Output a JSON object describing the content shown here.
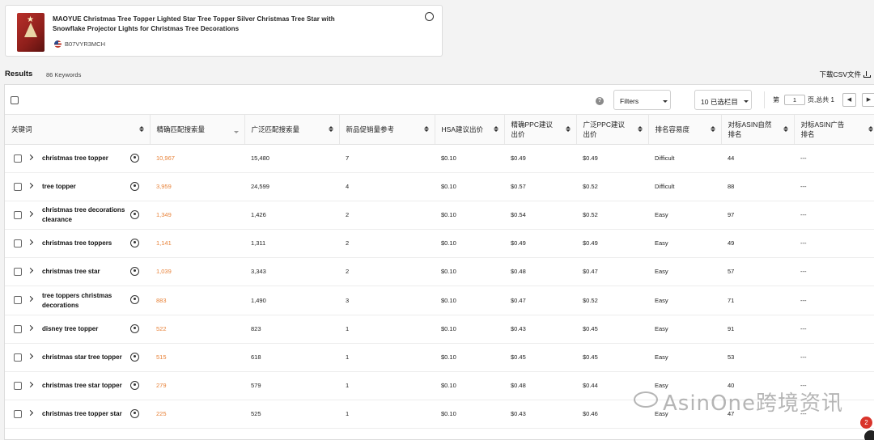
{
  "product": {
    "title": "MAOYUE Christmas Tree Topper Lighted Star Tree Topper Silver Christmas Tree Star with Snowflake Projector Lights for Christmas Tree Decorations",
    "asin": "B07VYR3MCH"
  },
  "results": {
    "label": "Results",
    "count": "86 Keywords",
    "download": "下载CSV文件"
  },
  "toolbar": {
    "filters": "Filters",
    "columns": "10 已选栏目",
    "page_prefix": "第",
    "page_value": "1",
    "page_suffix": "页,总共 1",
    "prev": "◀",
    "next": "▶"
  },
  "table": {
    "headers": [
      "关键词",
      "精确匹配搜索量",
      "广泛匹配搜索量",
      "新品促销量参考",
      "HSA建议出价",
      "精确PPC建议出价",
      "广泛PPC建议出价",
      "排名容易度",
      "对标ASIN自然排名",
      "对标ASIN广告排名"
    ],
    "rows": [
      {
        "keyword": "christmas tree topper",
        "exact": "10,967",
        "broad": "15,480",
        "promo": "7",
        "hsa": "$0.10",
        "ppc_exact": "$0.49",
        "ppc_broad": "$0.49",
        "ease": "Difficult",
        "organic": "44",
        "ad": "---"
      },
      {
        "keyword": "tree topper",
        "exact": "3,959",
        "broad": "24,599",
        "promo": "4",
        "hsa": "$0.10",
        "ppc_exact": "$0.57",
        "ppc_broad": "$0.52",
        "ease": "Difficult",
        "organic": "88",
        "ad": "---"
      },
      {
        "keyword": "christmas tree decorations clearance",
        "exact": "1,349",
        "broad": "1,426",
        "promo": "2",
        "hsa": "$0.10",
        "ppc_exact": "$0.54",
        "ppc_broad": "$0.52",
        "ease": "Easy",
        "organic": "97",
        "ad": "---"
      },
      {
        "keyword": "christmas tree toppers",
        "exact": "1,141",
        "broad": "1,311",
        "promo": "2",
        "hsa": "$0.10",
        "ppc_exact": "$0.49",
        "ppc_broad": "$0.49",
        "ease": "Easy",
        "organic": "49",
        "ad": "---"
      },
      {
        "keyword": "christmas tree star",
        "exact": "1,039",
        "broad": "3,343",
        "promo": "2",
        "hsa": "$0.10",
        "ppc_exact": "$0.48",
        "ppc_broad": "$0.47",
        "ease": "Easy",
        "organic": "57",
        "ad": "---"
      },
      {
        "keyword": "tree toppers christmas decorations",
        "exact": "883",
        "broad": "1,490",
        "promo": "3",
        "hsa": "$0.10",
        "ppc_exact": "$0.47",
        "ppc_broad": "$0.52",
        "ease": "Easy",
        "organic": "71",
        "ad": "---"
      },
      {
        "keyword": "disney tree topper",
        "exact": "522",
        "broad": "823",
        "promo": "1",
        "hsa": "$0.10",
        "ppc_exact": "$0.43",
        "ppc_broad": "$0.45",
        "ease": "Easy",
        "organic": "91",
        "ad": "---"
      },
      {
        "keyword": "christmas star tree topper",
        "exact": "515",
        "broad": "618",
        "promo": "1",
        "hsa": "$0.10",
        "ppc_exact": "$0.45",
        "ppc_broad": "$0.45",
        "ease": "Easy",
        "organic": "53",
        "ad": "---"
      },
      {
        "keyword": "christmas tree star topper",
        "exact": "279",
        "broad": "579",
        "promo": "1",
        "hsa": "$0.10",
        "ppc_exact": "$0.48",
        "ppc_broad": "$0.44",
        "ease": "Easy",
        "organic": "40",
        "ad": "---"
      },
      {
        "keyword": "christmas tree topper star",
        "exact": "225",
        "broad": "525",
        "promo": "1",
        "hsa": "$0.10",
        "ppc_exact": "$0.43",
        "ppc_broad": "$0.46",
        "ease": "Easy",
        "organic": "47",
        "ad": "---"
      }
    ]
  },
  "overlay": {
    "watermark": "AsinOne跨境资讯",
    "badge": "2"
  }
}
